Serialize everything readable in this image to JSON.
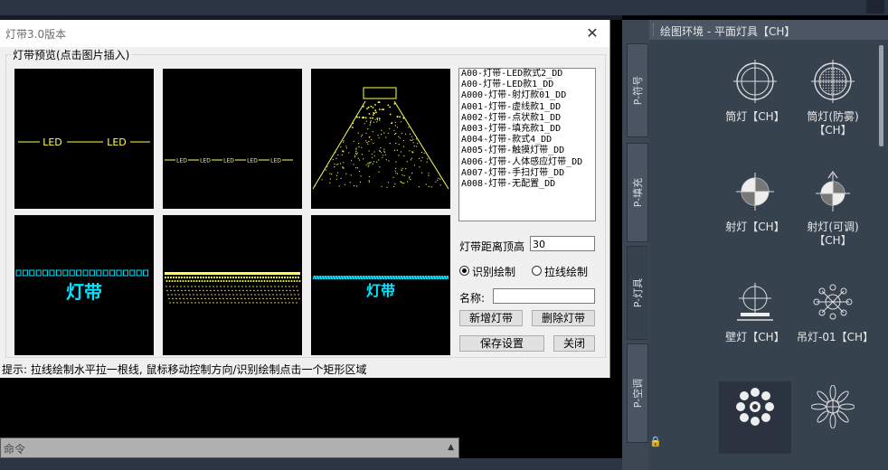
{
  "dialog": {
    "title": "灯带3.0版本",
    "group_label": "灯带预览(点击图片插入)",
    "previews": {
      "led_text": "LED",
      "tiny_led": "LED",
      "strip_label": "灯带"
    },
    "list_items": [
      "A00-灯带-LED款式2_DD",
      "A00-灯带-LED款1_DD",
      "A000-灯带-射灯款01_DD",
      "A001-灯带-虚线款1_DD",
      "A002-灯带-点状款1_DD",
      "A003-灯带-填充款1_DD",
      "A004-灯带-款式4_DD",
      "A005-灯带-触摸灯带_DD",
      "A006-灯带-人体感应灯带_DD",
      "A007-灯带-手扫灯带_DD",
      "A008-灯带-无配置_DD"
    ],
    "distance_label": "灯带距离顶高",
    "distance_value": "30",
    "radio_recognize": "识别绘制",
    "radio_line": "拉线绘制",
    "name_label": "名称:",
    "name_value": "",
    "add_button": "新增灯带",
    "delete_button": "删除灯带",
    "save_button": "保存设置",
    "close_button": "关闭",
    "hint": "提示: 拉线绘制水平拉一根线, 鼠标移动控制方向/识别绘制点击一个矩形区域"
  },
  "command": {
    "placeholder": "命令"
  },
  "palette": {
    "title": "绘图环境 - 平面灯具【CH】",
    "tabs": [
      "P-符号",
      "P-填充",
      "P-灯具",
      "P-空调"
    ],
    "active_tab": "P-灯具",
    "tools": [
      {
        "name": "筒灯【CH】",
        "icon": "downlight-icon"
      },
      {
        "name": "筒灯(防雾)【CH】",
        "icon": "fogproof-downlight-icon"
      },
      {
        "name": "射灯【CH】",
        "icon": "spotlight-icon"
      },
      {
        "name": "射灯(可调)【CH】",
        "icon": "adjustable-spotlight-icon"
      },
      {
        "name": "壁灯【CH】",
        "icon": "wall-lamp-icon"
      },
      {
        "name": "吊灯-01【CH】",
        "icon": "chandelier-icon"
      },
      {
        "name": "",
        "icon": "chandelier-2-icon"
      },
      {
        "name": "",
        "icon": "pendant-star-icon"
      }
    ]
  },
  "colors": {
    "led_yellow": "#ffff55",
    "strip_cyan": "#00e5ff",
    "palette_bg": "#37424f"
  }
}
